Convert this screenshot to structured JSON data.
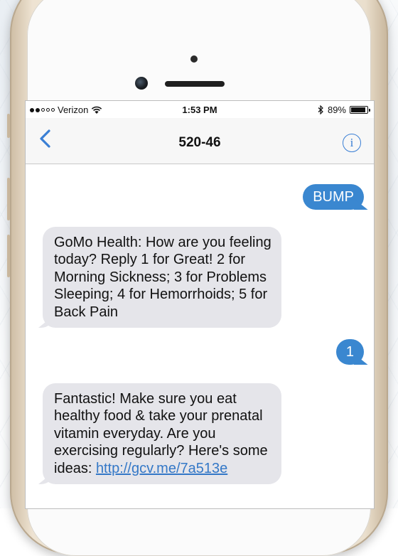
{
  "status_bar": {
    "carrier": "Verizon",
    "time": "1:53 PM",
    "battery": "89%",
    "battery_level": 0.89,
    "signal_dots_filled": 2,
    "signal_dots_total": 5
  },
  "nav": {
    "title": "520-46",
    "info_glyph": "i",
    "back_icon": "chevron-left-icon",
    "accent": "#3a7fd5"
  },
  "messages": [
    {
      "direction": "outgoing",
      "text": "BUMP"
    },
    {
      "direction": "incoming",
      "text": "GoMo Health: How are you feeling today? Reply 1 for Great! 2 for Morning Sickness; 3 for Problems Sleeping; 4 for Hemorrhoids; 5 for Back Pain"
    },
    {
      "direction": "outgoing",
      "text": "1"
    },
    {
      "direction": "incoming",
      "text": "Fantastic! Make sure you eat healthy food & take your prenatal vitamin everyday. Are you exercising regularly? Here's some ideas: ",
      "link": "http://gcv.me/7a513e"
    }
  ],
  "colors": {
    "outgoing_bubble": "#3a87d0",
    "incoming_bubble": "#e5e5ea"
  }
}
